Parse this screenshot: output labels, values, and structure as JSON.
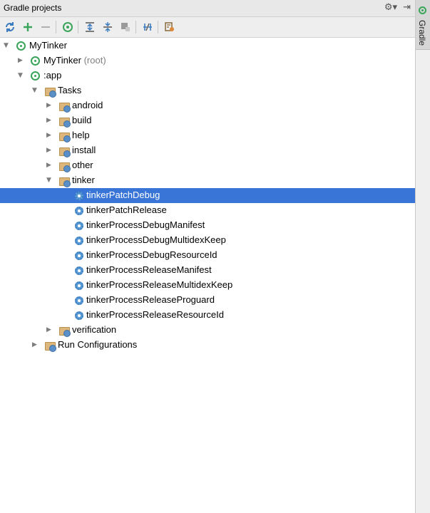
{
  "panel": {
    "title": "Gradle projects",
    "side_tab_label": "Gradle",
    "title_icons": [
      "gear-dropdown-icon",
      "hide-panel-icon"
    ]
  },
  "toolbar": {
    "icons": [
      "refresh-icon",
      "add-icon",
      "remove-icon",
      "execute-task-icon",
      "expand-all-icon",
      "collapse-all-icon",
      "offline-mode-icon",
      "toggle-dependencies-icon",
      "gradle-settings-icon"
    ]
  },
  "tree": {
    "root": {
      "label": "MyTinker",
      "expanded": true
    },
    "root_project": {
      "label": "MyTinker",
      "suffix": "(root)",
      "expanded": false
    },
    "app": {
      "label": ":app",
      "expanded": true
    },
    "tasks": {
      "label": "Tasks",
      "expanded": true
    },
    "groups": [
      {
        "label": "android",
        "expanded": false
      },
      {
        "label": "build",
        "expanded": false
      },
      {
        "label": "help",
        "expanded": false
      },
      {
        "label": "install",
        "expanded": false
      },
      {
        "label": "other",
        "expanded": false
      },
      {
        "label": "tinker",
        "expanded": true
      }
    ],
    "tinker_tasks": [
      {
        "label": "tinkerPatchDebug",
        "selected": true
      },
      {
        "label": "tinkerPatchRelease",
        "selected": false
      },
      {
        "label": "tinkerProcessDebugManifest",
        "selected": false
      },
      {
        "label": "tinkerProcessDebugMultidexKeep",
        "selected": false
      },
      {
        "label": "tinkerProcessDebugResourceId",
        "selected": false
      },
      {
        "label": "tinkerProcessReleaseManifest",
        "selected": false
      },
      {
        "label": "tinkerProcessReleaseMultidexKeep",
        "selected": false
      },
      {
        "label": "tinkerProcessReleaseProguard",
        "selected": false
      },
      {
        "label": "tinkerProcessReleaseResourceId",
        "selected": false
      }
    ],
    "verification": {
      "label": "verification",
      "expanded": false
    },
    "run_configurations": {
      "label": "Run Configurations",
      "expanded": false
    }
  },
  "colors": {
    "selection": "#3875d7",
    "gradle_green": "#3aa55a",
    "folder": "#dcb67a",
    "task_gear": "#5b9bd5"
  }
}
